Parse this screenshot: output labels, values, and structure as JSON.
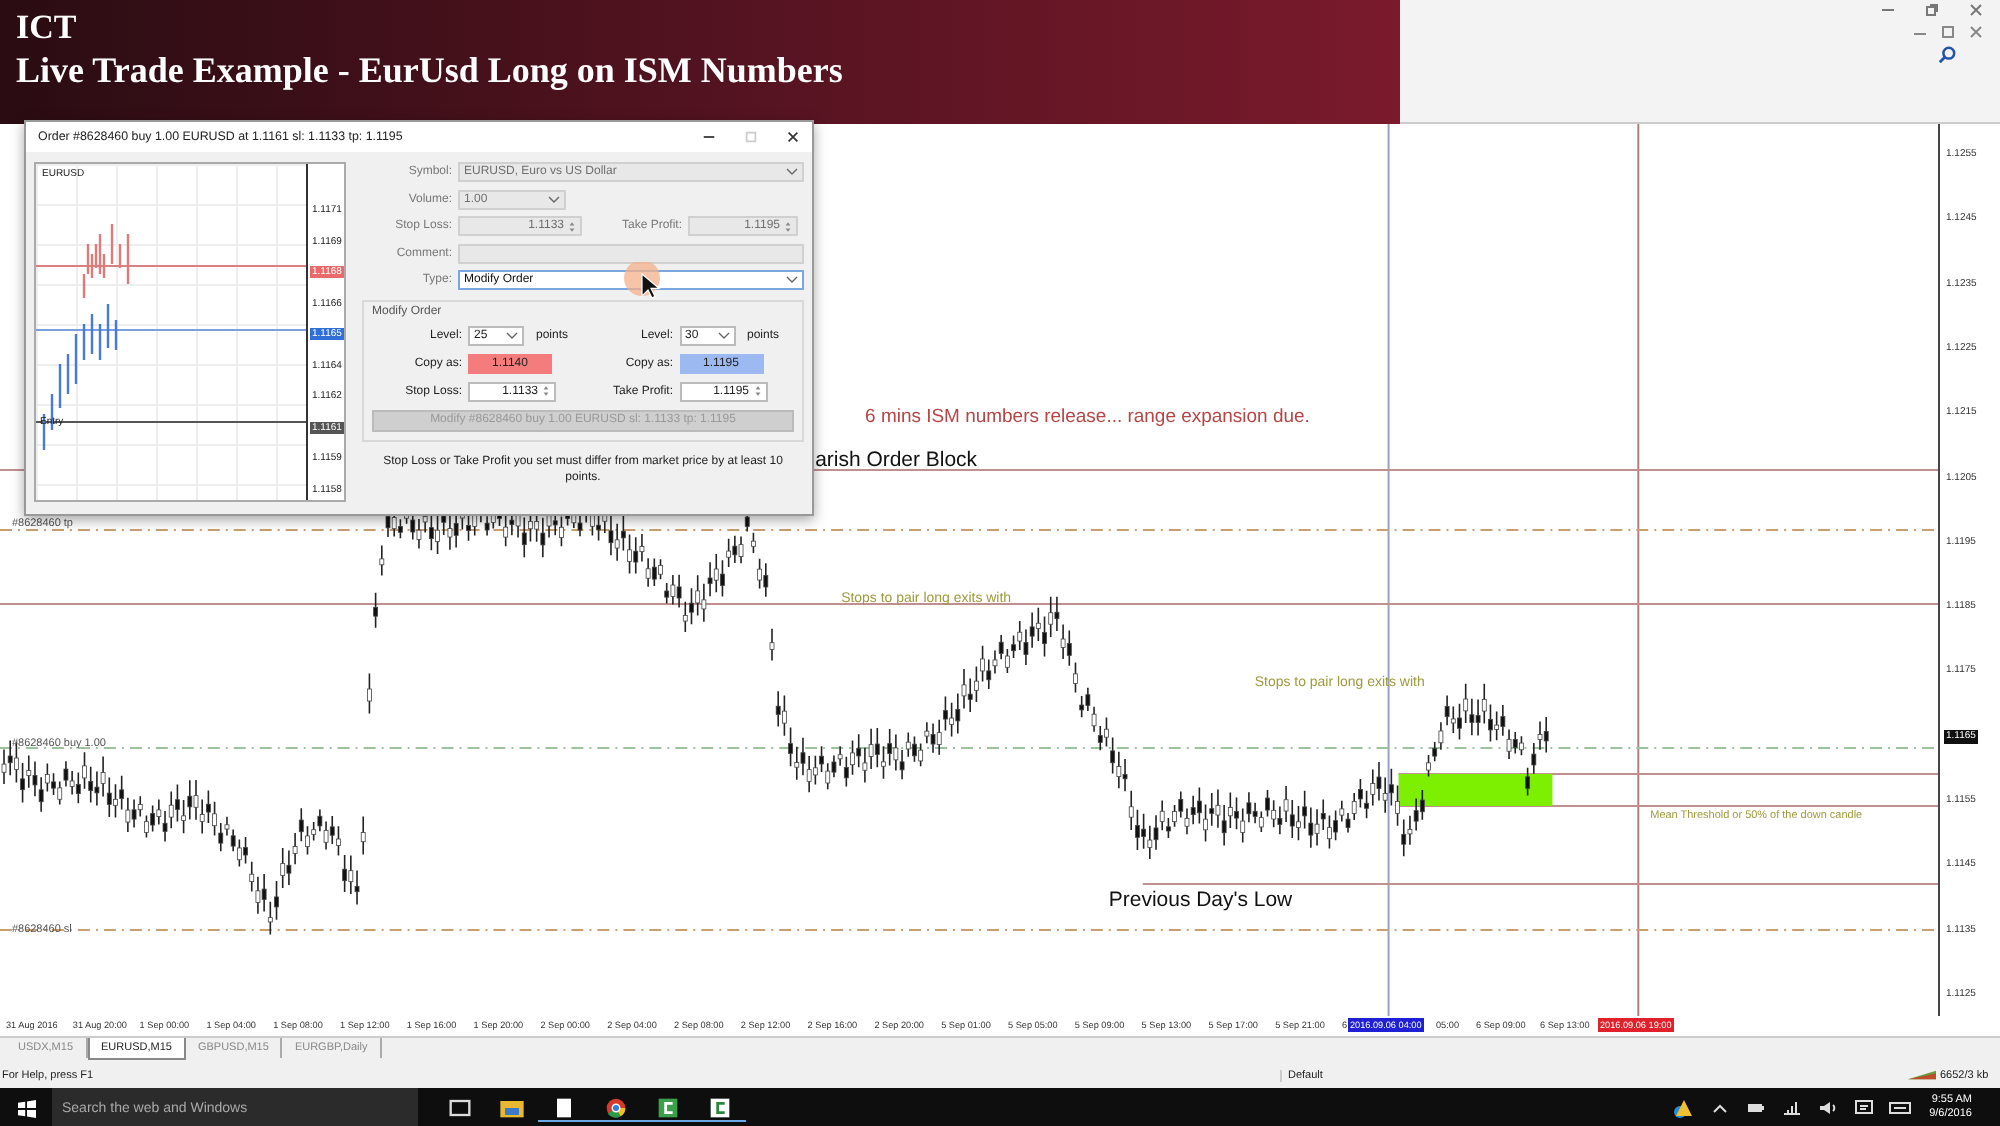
{
  "video_banner": {
    "line_1": "ICT",
    "line_2": "Live Trade Example - EurUsd Long on ISM Numbers"
  },
  "chart": {
    "price_axis": [
      {
        "label": "1.1255",
        "current": false
      },
      {
        "label": "1.1245",
        "current": false
      },
      {
        "label": "1.1235",
        "current": false
      },
      {
        "label": "1.1225",
        "current": false
      },
      {
        "label": "1.1215",
        "current": false
      },
      {
        "label": "1.1205",
        "current": false
      },
      {
        "label": "1.1195",
        "current": false
      },
      {
        "label": "1.1185",
        "current": false
      },
      {
        "label": "1.1175",
        "current": false
      },
      {
        "label": "1.1165",
        "current": true
      },
      {
        "label": "1.1155",
        "current": false
      },
      {
        "label": "1.1145",
        "current": false
      },
      {
        "label": "1.1135",
        "current": false
      },
      {
        "label": "1.1125",
        "current": false
      }
    ],
    "annotations": [
      {
        "text": "6 mins ISM numbers release... range expansion due.",
        "kind": "headline"
      },
      {
        "text": "arish Order Block",
        "kind": "level"
      },
      {
        "text": "#8628460 tp",
        "kind": "order"
      },
      {
        "text": "Stops to pair long exits with",
        "kind": "note"
      },
      {
        "text": "Stops to pair long exits with",
        "kind": "note"
      },
      {
        "text": "#8628460 buy 1.00",
        "kind": "order"
      },
      {
        "text": "Mean Threshold or 50% of the down candle",
        "kind": "note"
      },
      {
        "text": "Previous Day's Low",
        "kind": "level"
      },
      {
        "text": "#8628460 sl",
        "kind": "order"
      }
    ],
    "time_axis": [
      {
        "label": "31 Aug 2016",
        "kind": "tick"
      },
      {
        "label": "31 Aug 20:00",
        "kind": "tick"
      },
      {
        "label": "1 Sep 00:00",
        "kind": "tick"
      },
      {
        "label": "1 Sep 04:00",
        "kind": "tick"
      },
      {
        "label": "1 Sep 08:00",
        "kind": "tick"
      },
      {
        "label": "1 Sep 12:00",
        "kind": "tick"
      },
      {
        "label": "1 Sep 16:00",
        "kind": "tick"
      },
      {
        "label": "1 Sep 20:00",
        "kind": "tick"
      },
      {
        "label": "2 Sep 00:00",
        "kind": "tick"
      },
      {
        "label": "2 Sep 04:00",
        "kind": "tick"
      },
      {
        "label": "2 Sep 08:00",
        "kind": "tick"
      },
      {
        "label": "2 Sep 12:00",
        "kind": "tick"
      },
      {
        "label": "2 Sep 16:00",
        "kind": "tick"
      },
      {
        "label": "2 Sep 20:00",
        "kind": "tick"
      },
      {
        "label": "5 Sep 01:00",
        "kind": "tick"
      },
      {
        "label": "5 Sep 05:00",
        "kind": "tick"
      },
      {
        "label": "5 Sep 09:00",
        "kind": "tick"
      },
      {
        "label": "5 Sep 13:00",
        "kind": "tick"
      },
      {
        "label": "5 Sep 17:00",
        "kind": "tick"
      },
      {
        "label": "5 Sep 21:00",
        "kind": "tick"
      },
      {
        "label": "6",
        "kind": "tick"
      },
      {
        "label": "2016.09.06 04:00",
        "kind": "marker",
        "color": "#1f1fd6"
      },
      {
        "label": "05:00",
        "kind": "tick"
      },
      {
        "label": "6 Sep 09:00",
        "kind": "tick"
      },
      {
        "label": "6 Sep 13:00",
        "kind": "tick"
      },
      {
        "label": "2016.09.06 19:00",
        "kind": "marker",
        "color": "#e0202a"
      }
    ]
  },
  "order_dialog": {
    "title": "Order #8628460 buy 1.00 EURUSD at 1.1161 sl: 1.1133 tp: 1.1195",
    "mini_chart": {
      "symbol": "EURUSD",
      "entry_label": "Entry",
      "price_labels": [
        {
          "label": "1.1171"
        },
        {
          "label": "1.1169"
        },
        {
          "label": "1.1168",
          "color": "#e86a6a"
        },
        {
          "label": "1.1166"
        },
        {
          "label": "1.1165",
          "color": "#2f6fd6"
        },
        {
          "label": "1.1164"
        },
        {
          "label": "1.1162"
        },
        {
          "label": "1.1161",
          "color": "#555555"
        },
        {
          "label": "1.1159"
        },
        {
          "label": "1.1158"
        }
      ]
    },
    "fields": [
      [
        {
          "label": "Symbol:",
          "value": "EURUSD, Euro vs US Dollar",
          "kind": "dropdown",
          "disabled": true
        }
      ],
      [
        {
          "label": "Volume:",
          "value": "1.00",
          "kind": "dropdown",
          "disabled": true
        }
      ],
      [
        {
          "label": "Stop Loss:",
          "value": "1.1133",
          "kind": "spinner",
          "disabled": true
        },
        {
          "label": "Take Profit:",
          "value": "1.1195",
          "kind": "spinner",
          "disabled": true
        }
      ],
      [
        {
          "label": "Comment:",
          "kind": "text",
          "disabled": true
        }
      ],
      [
        {
          "label": "Type:",
          "value": "Modify Order",
          "kind": "dropdown",
          "disabled": false
        }
      ]
    ],
    "modify_group": {
      "title": "Modify Order",
      "levels": [
        {
          "label": "Level:",
          "value": "25",
          "unit": "points"
        },
        {
          "label": "Level:",
          "value": "30",
          "unit": "points"
        }
      ],
      "copies": [
        {
          "label": "Copy as:",
          "value": "1.1140",
          "color": "#f47c7c"
        },
        {
          "label": "Copy as:",
          "value": "1.1195",
          "color": "#9db9f2"
        }
      ],
      "stops": [
        {
          "label": "Stop Loss:",
          "value": "1.1133"
        },
        {
          "label": "Take Profit:",
          "value": "1.1195"
        }
      ],
      "button": {
        "label": "Modify #8628460 buy 1.00 EURUSD sl: 1.1133 tp: 1.1195",
        "disabled": true
      },
      "note": "Stop Loss or Take Profit you set must differ from market price by at least 10 points."
    }
  },
  "symbol_tabs": [
    {
      "label": "USDX,M15",
      "selected": false
    },
    {
      "label": "EURUSD,M15",
      "selected": true
    },
    {
      "label": "GBPUSD,M15",
      "selected": false
    },
    {
      "label": "EURGBP,Daily",
      "selected": false
    }
  ],
  "status_bar": {
    "help": "For Help, press F1",
    "profile": "Default",
    "traffic": "6652/3 kb"
  },
  "taskbar": {
    "search": {
      "placeholder": "Search the web and Windows"
    },
    "time": "9:55 AM",
    "date": "9/6/2016"
  }
}
